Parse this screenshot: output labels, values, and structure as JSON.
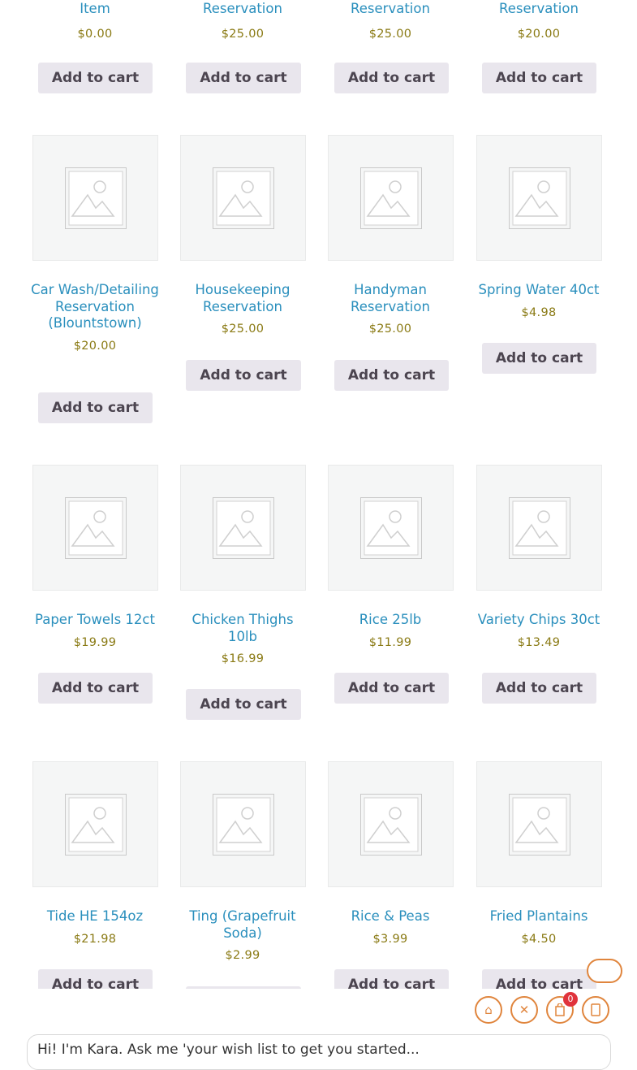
{
  "add_to_cart_label": "Add to cart",
  "placeholder_icon": "image-placeholder-icon",
  "rows": [
    {
      "products": [
        {
          "name": "Item",
          "price": "$0.00"
        },
        {
          "name": "Reservation",
          "price": "$25.00"
        },
        {
          "name": "Reservation",
          "price": "$25.00"
        },
        {
          "name": "Reservation",
          "price": "$20.00"
        }
      ]
    },
    {
      "products": [
        {
          "name": "Car Wash/Detailing Reservation (Blountstown)",
          "price": "$20.00"
        },
        {
          "name": "Housekeeping Reservation",
          "price": "$25.00"
        },
        {
          "name": "Handyman Reservation",
          "price": "$25.00"
        },
        {
          "name": "Spring Water 40ct",
          "price": "$4.98"
        }
      ]
    },
    {
      "products": [
        {
          "name": "Paper Towels 12ct",
          "price": "$19.99"
        },
        {
          "name": "Chicken Thighs 10lb",
          "price": "$16.99"
        },
        {
          "name": "Rice 25lb",
          "price": "$11.99"
        },
        {
          "name": "Variety Chips 30ct",
          "price": "$13.49"
        }
      ]
    },
    {
      "products": [
        {
          "name": "Tide HE 154oz",
          "price": "$21.98"
        },
        {
          "name": "Ting (Grapefruit Soda)",
          "price": "$2.99"
        },
        {
          "name": "Rice & Peas",
          "price": "$3.99"
        },
        {
          "name": "Fried Plantains",
          "price": "$4.50"
        }
      ]
    }
  ],
  "floating_bar": {
    "home_icon": "home-icon",
    "close_icon": "close-icon",
    "cart_icon": "cart-icon",
    "cart_count": "0",
    "menu_icon": "menu-icon"
  },
  "chat": {
    "text": "Hi! I'm Kara. Ask me 'your wish list to get you started..."
  },
  "colors": {
    "link": "#2a8fbd",
    "price": "#8a7a14",
    "button_bg": "#e9e6ed",
    "accent": "#e0853d"
  }
}
